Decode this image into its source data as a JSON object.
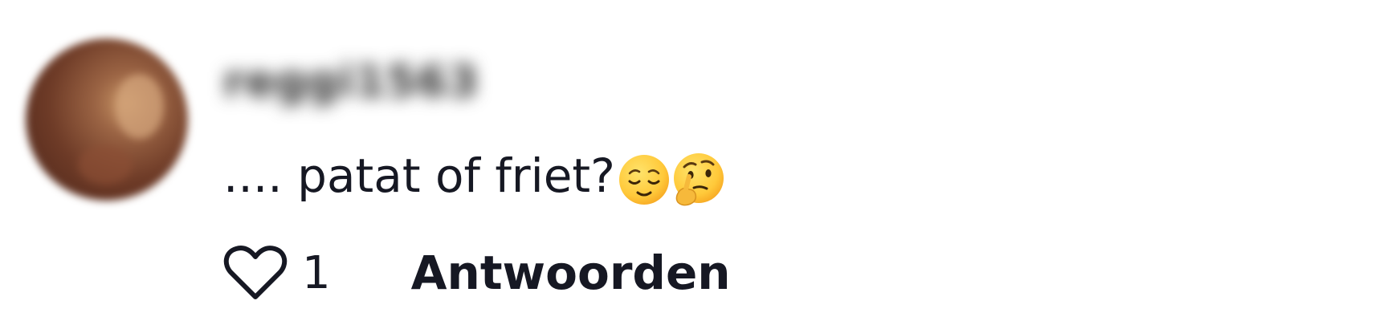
{
  "comment": {
    "username": "reggi1563",
    "text": ".... patat of friet?",
    "emojis": [
      "relieved-face",
      "thinking-face"
    ],
    "like_count": "1",
    "reply_label": "Antwoorden"
  },
  "colors": {
    "text": "#161823",
    "background": "#ffffff"
  }
}
